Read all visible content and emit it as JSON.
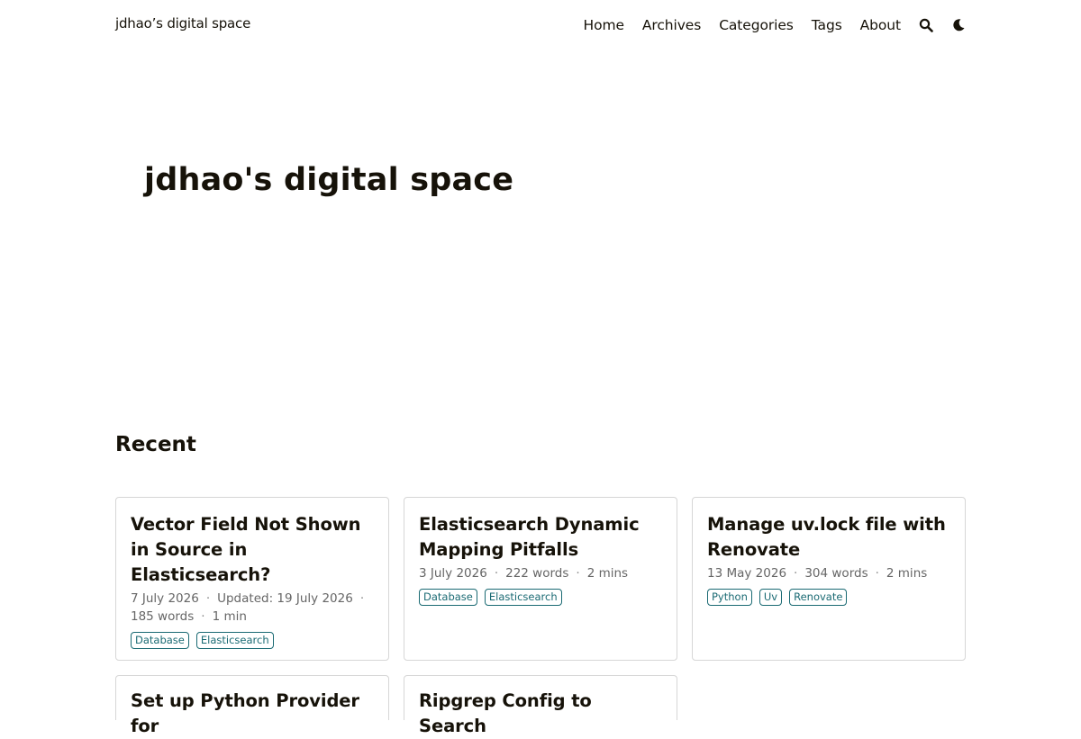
{
  "header": {
    "site_title": "jdhao’s digital space",
    "nav": [
      "Home",
      "Archives",
      "Categories",
      "Tags",
      "About"
    ],
    "icons": [
      "search-icon",
      "theme-toggle-icon"
    ]
  },
  "hero": {
    "title": "jdhao's digital space"
  },
  "recent": {
    "heading": "Recent",
    "posts": [
      {
        "title": "Vector Field Not Shown in Source in Elasticsearch?",
        "date": "7 July 2026",
        "updated": "Updated: 19 July 2026",
        "words": "185 words",
        "time": "1 min",
        "tags": [
          "Database",
          "Elasticsearch"
        ]
      },
      {
        "title": "Elasticsearch Dynamic Mapping Pitfalls",
        "date": "3 July 2026",
        "words": "222 words",
        "time": "2 mins",
        "tags": [
          "Database",
          "Elasticsearch"
        ]
      },
      {
        "title": "Manage uv.lock file with Renovate",
        "date": "13 May 2026",
        "words": "304 words",
        "time": "2 mins",
        "tags": [
          "Python",
          "Uv",
          "Renovate"
        ]
      },
      {
        "title": "Set up Python Provider for"
      },
      {
        "title": "Ripgrep Config to Search"
      }
    ]
  }
}
